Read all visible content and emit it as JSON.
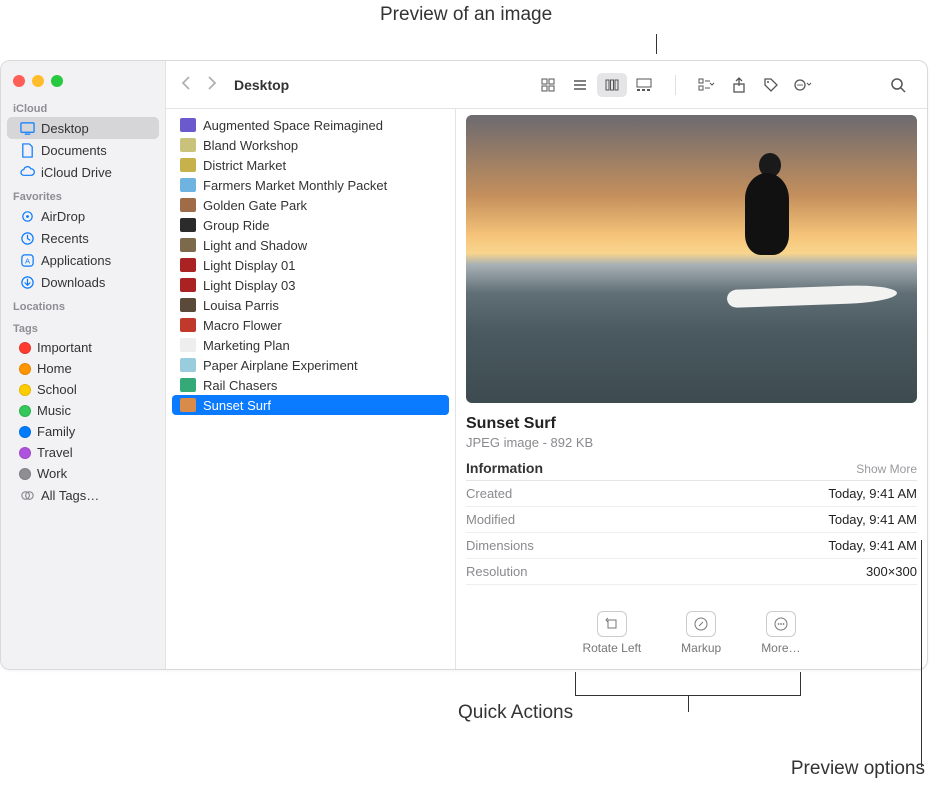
{
  "callouts": {
    "preview_image": "Preview of an image",
    "quick_actions": "Quick Actions",
    "preview_options": "Preview options"
  },
  "toolbar": {
    "title": "Desktop"
  },
  "sidebar": {
    "sections": {
      "icloud": "iCloud",
      "favorites": "Favorites",
      "locations": "Locations",
      "tags": "Tags"
    },
    "icloud_items": [
      {
        "label": "Desktop"
      },
      {
        "label": "Documents"
      },
      {
        "label": "iCloud Drive"
      }
    ],
    "favorites_items": [
      {
        "label": "AirDrop"
      },
      {
        "label": "Recents"
      },
      {
        "label": "Applications"
      },
      {
        "label": "Downloads"
      }
    ],
    "tags_items": [
      {
        "label": "Important",
        "color": "#ff3b30"
      },
      {
        "label": "Home",
        "color": "#ff9500"
      },
      {
        "label": "School",
        "color": "#ffcc00"
      },
      {
        "label": "Music",
        "color": "#34c759"
      },
      {
        "label": "Family",
        "color": "#007aff"
      },
      {
        "label": "Travel",
        "color": "#af52de"
      },
      {
        "label": "Work",
        "color": "#8e8e93"
      },
      {
        "label": "All Tags…",
        "color": null
      }
    ]
  },
  "files": [
    {
      "label": "Augmented Space Reimagined",
      "thumb": "#6a5acd"
    },
    {
      "label": "Bland Workshop",
      "thumb": "#c9c27a"
    },
    {
      "label": "District Market",
      "thumb": "#c6b14a"
    },
    {
      "label": "Farmers Market Monthly Packet",
      "thumb": "#6fb3e0"
    },
    {
      "label": "Golden Gate Park",
      "thumb": "#a06c48"
    },
    {
      "label": "Group Ride",
      "thumb": "#2b2b2b"
    },
    {
      "label": "Light and Shadow",
      "thumb": "#7d6a4c"
    },
    {
      "label": "Light Display 01",
      "thumb": "#a22"
    },
    {
      "label": "Light Display 03",
      "thumb": "#a22"
    },
    {
      "label": "Louisa Parris",
      "thumb": "#5a4a3a"
    },
    {
      "label": "Macro Flower",
      "thumb": "#c0392b"
    },
    {
      "label": "Marketing Plan",
      "thumb": "#eee"
    },
    {
      "label": "Paper Airplane Experiment",
      "thumb": "#9cd"
    },
    {
      "label": "Rail Chasers",
      "thumb": "#3a7"
    },
    {
      "label": "Sunset Surf",
      "thumb": "#d98b4a"
    }
  ],
  "preview": {
    "title": "Sunset Surf",
    "subtitle": "JPEG image - 892 KB",
    "info_header": "Information",
    "show_more": "Show More",
    "rows": [
      {
        "k": "Created",
        "v": "Today, 9:41 AM"
      },
      {
        "k": "Modified",
        "v": "Today, 9:41 AM"
      },
      {
        "k": "Dimensions",
        "v": "Today, 9:41 AM"
      },
      {
        "k": "Resolution",
        "v": "300×300"
      }
    ],
    "quick_actions": [
      {
        "label": "Rotate Left"
      },
      {
        "label": "Markup"
      },
      {
        "label": "More…"
      }
    ]
  }
}
